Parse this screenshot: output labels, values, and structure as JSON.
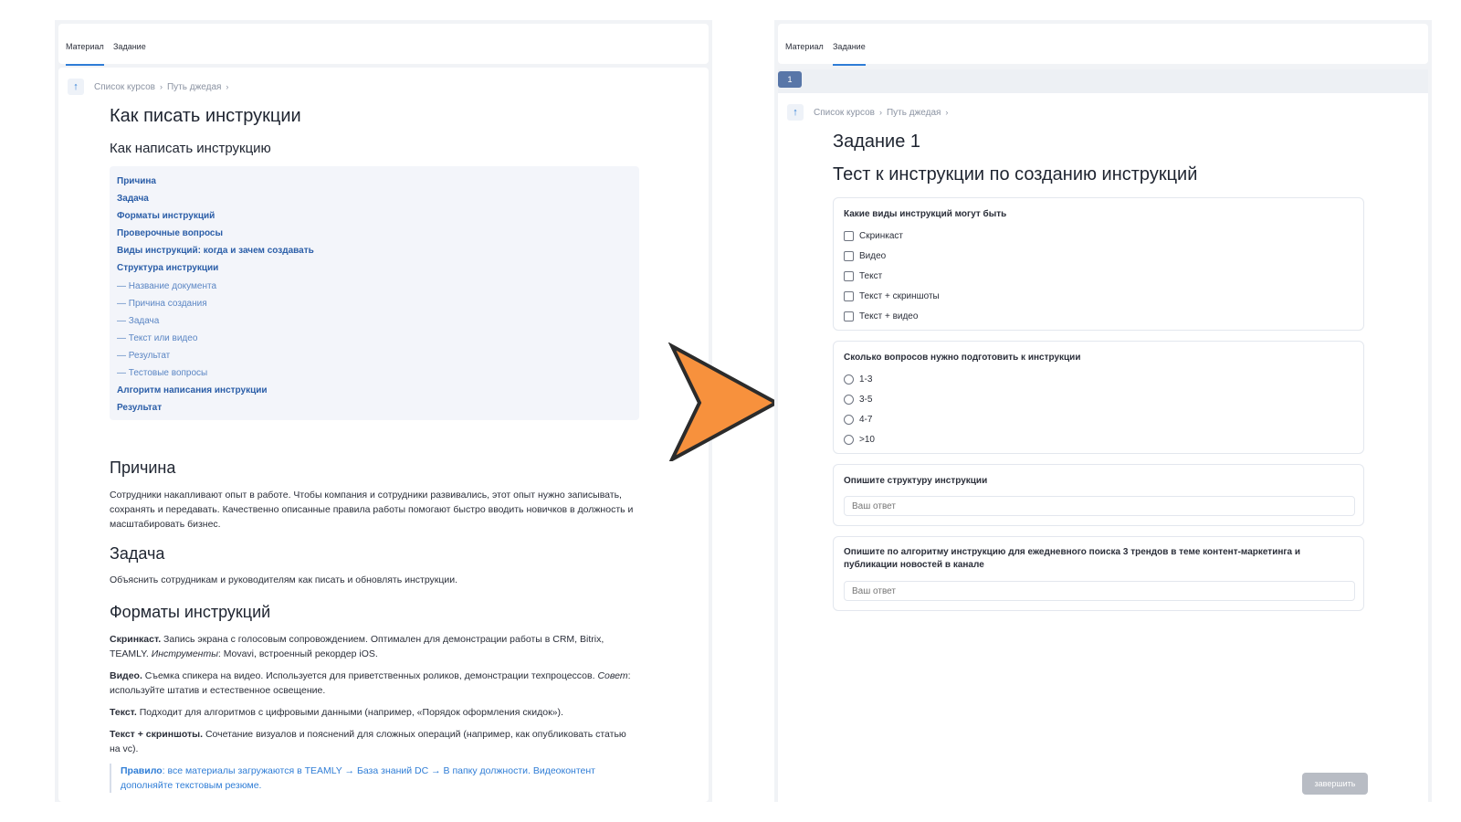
{
  "left": {
    "tabs": [
      "Материал",
      "Задание"
    ],
    "breadcrumb": [
      "Список курсов",
      "Путь джедая"
    ],
    "title": "Как писать инструкции",
    "subtitle": "Как написать инструкцию",
    "toc": [
      {
        "label": "Причина",
        "sub": false
      },
      {
        "label": "Задача",
        "sub": false
      },
      {
        "label": "Форматы инструкций",
        "sub": false
      },
      {
        "label": "Проверочные вопросы",
        "sub": false
      },
      {
        "label": "Виды инструкций: когда и зачем создавать",
        "sub": false
      },
      {
        "label": "Структура инструкции",
        "sub": false
      },
      {
        "label": "— Название документа",
        "sub": true
      },
      {
        "label": "— Причина создания",
        "sub": true
      },
      {
        "label": "— Задача",
        "sub": true
      },
      {
        "label": "— Текст или видео",
        "sub": true
      },
      {
        "label": "— Результат",
        "sub": true
      },
      {
        "label": "— Тестовые вопросы",
        "sub": true
      },
      {
        "label": "Алгоритм написания инструкции",
        "sub": false
      },
      {
        "label": "Результат",
        "sub": false
      }
    ],
    "reason_heading": "Причина",
    "reason_text": "Сотрудники накапливают опыт в работе. Чтобы компания и сотрудники развивались, этот опыт нужно записывать, сохранять и передавать. Качественно описанные правила работы помогают быстро вводить новичков в должность и масштабировать бизнес.",
    "task_heading": "Задача",
    "task_text": "Объяснить сотрудникам и руководителям как писать и обновлять инструкции.",
    "formats_heading": "Форматы инструкций",
    "formats": [
      {
        "bold": "Скринкаст.",
        "text": " Запись экрана с голосовым сопровождением. Оптимален для демонстрации работы в CRM, Bitrix, TEAMLY. ",
        "italic": "Инструменты",
        "tail": ": Movavi, встроенный рекордер iOS."
      },
      {
        "bold": "Видео.",
        "text": " Съемка спикера на видео. Используется для приветственных роликов, демонстрации техпроцессов. ",
        "italic": "Совет",
        "tail": ": используйте штатив и естественное освещение."
      },
      {
        "bold": "Текст.",
        "text": " Подходит для алгоритмов с цифровыми данными (например, «Порядок оформления скидок»).",
        "italic": "",
        "tail": ""
      },
      {
        "bold": "Текст + скриншоты.",
        "text": " Сочетание визуалов и пояснений для сложных операций (например, как опубликовать статью на vc).",
        "italic": "",
        "tail": ""
      }
    ],
    "rule_bold": "Правило",
    "rule_text": ": все материалы загружаются в TEAMLY → База знаний DC → В папку должности. Видеоконтент дополняйте текстовым резюме."
  },
  "right": {
    "tabs": [
      "Материал",
      "Задание"
    ],
    "page": "1",
    "breadcrumb": [
      "Список курсов",
      "Путь джедая"
    ],
    "title": "Задание 1",
    "subtitle": "Тест к инструкции по созданию инструкций",
    "q1": {
      "title": "Какие виды инструкций могут быть",
      "options": [
        "Скринкаст",
        "Видео",
        "Текст",
        "Текст + скриншоты",
        "Текст + видео"
      ]
    },
    "q2": {
      "title": "Сколько вопросов нужно подготовить к инструкции",
      "options": [
        "1-3",
        "3-5",
        "4-7",
        ">10"
      ]
    },
    "q3": {
      "title": "Опишите структуру инструкции",
      "placeholder": "Ваш ответ"
    },
    "q4": {
      "title": "Опишите по алгоритму инструкцию для ежедневного поиска 3 трендов в теме контент-маркетинга и публикации новостей в канале",
      "placeholder": "Ваш ответ"
    },
    "finish_label": "завершить"
  },
  "colors": {
    "accent": "#2f7dd6",
    "toc_bg": "#f3f5fa",
    "arrow_fill": "#f7913d",
    "page_badge": "#5876a8"
  },
  "icons": {
    "up": "arrow-up-icon",
    "next": "chevron-right-arrow-icon"
  }
}
